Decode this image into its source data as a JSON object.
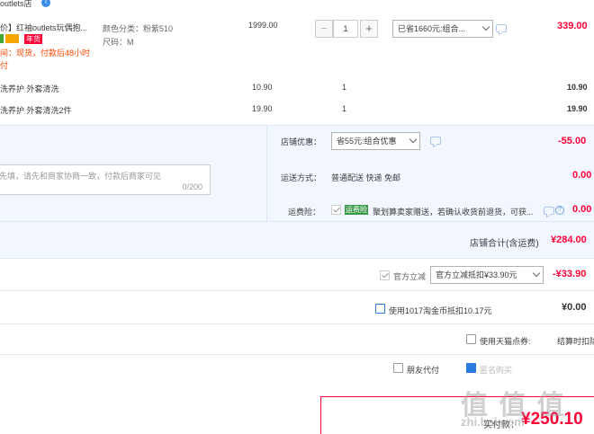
{
  "shop": {
    "name": "outlets店"
  },
  "item": {
    "title": "价】红袖outlets玩偶抱...",
    "promo_tag": "年货",
    "delivery_note": "间：现货，付款后48小时",
    "delivery_note2": "付",
    "color_label": "颜色分类：粉紫510",
    "size_label": "尺码：M",
    "unit_price": "1999.00",
    "quantity": "1",
    "minus": "−",
    "plus": "+",
    "discount_select": "已省1660元:组合...",
    "subtotal": "339.00"
  },
  "services": [
    {
      "name": "洗养护 外套清洗",
      "price": "10.90",
      "qty": "1",
      "total": "10.90"
    },
    {
      "name": "洗养护 外套清洗2件",
      "price": "19.90",
      "qty": "1",
      "total": "19.90"
    }
  ],
  "shop_discount": {
    "label": "店铺优惠：",
    "select": "省55元:组合优惠",
    "amount": "-55.00"
  },
  "message": {
    "placeholder": "先填，请先和商家协商一致，付款后商家可见",
    "counter": "0/200"
  },
  "shipping": {
    "label": "运送方式：",
    "method": "普通配送 快递 免邮",
    "amount": "0.00"
  },
  "insurance": {
    "label": "运费险：",
    "badge": "运费险",
    "text": "聚划算卖家赠送，若确认收货前退货，可获...",
    "amount": "0.00"
  },
  "shop_total": {
    "label": "店铺合计(含运费)",
    "amount": "¥284.00"
  },
  "official_discount": {
    "label": "官方立减",
    "select": "官方立减抵扣¥33.90元",
    "amount": "-¥33.90"
  },
  "coins": {
    "label": "使用1017淘金币抵扣10.17元",
    "amount": "¥0.00"
  },
  "tmall_card": {
    "label": "使用天猫点券:",
    "right": "结算时扣除"
  },
  "friend_pay": {
    "label": "朋友代付",
    "other": "匿名购买"
  },
  "payable": {
    "label": "实付款：",
    "amount": "¥250.10"
  },
  "watermark": {
    "text": "值 值 值",
    "sub": "zhi.bai.com"
  },
  "colors": {
    "red": "#ff0036",
    "orange": "#f40",
    "blue_band": "#f2f7ff",
    "link_blue": "#3d8ee8"
  }
}
